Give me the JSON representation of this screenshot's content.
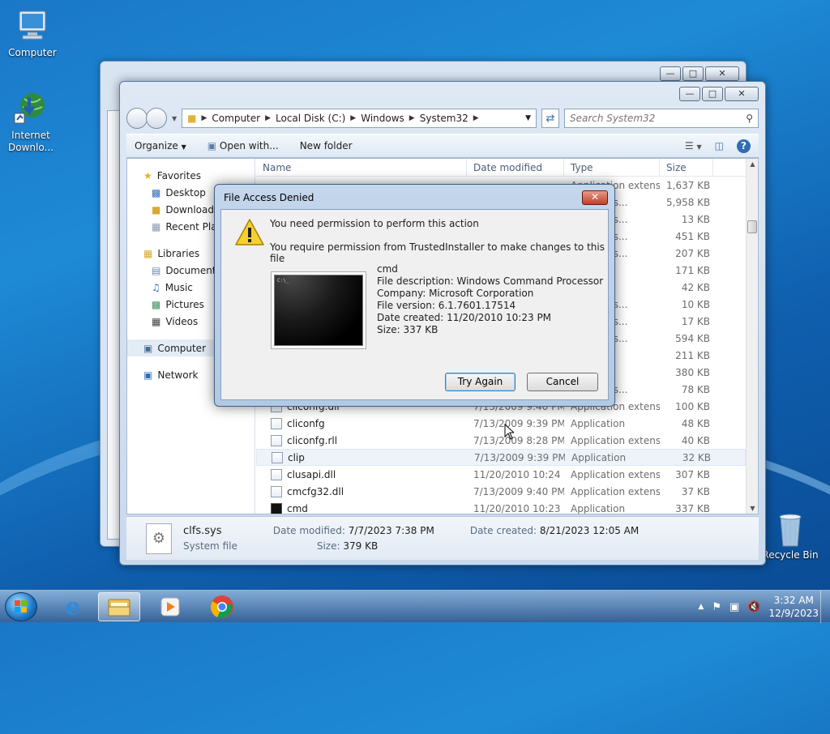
{
  "desktop": {
    "icons": [
      {
        "label": "Computer"
      },
      {
        "label": "Internet\nDownlo..."
      },
      {
        "label": "Recycle Bin"
      }
    ]
  },
  "explorer": {
    "breadcrumb": [
      "Computer",
      "Local Disk (C:)",
      "Windows",
      "System32"
    ],
    "search_placeholder": "Search System32",
    "toolbar": {
      "organize": "Organize",
      "open_with": "Open with...",
      "new_folder": "New folder"
    },
    "nav": {
      "favorites": "Favorites",
      "desktop": "Desktop",
      "downloads": "Downloads",
      "recent": "Recent Plac",
      "libraries": "Libraries",
      "documents": "Documents",
      "music": "Music",
      "pictures": "Pictures",
      "videos": "Videos",
      "computer": "Computer",
      "network": "Network"
    },
    "columns": {
      "name": "Name",
      "date": "Date modified",
      "type": "Type",
      "size": "Size"
    },
    "rows": [
      {
        "name": "",
        "date": "",
        "type": "Application extens...",
        "size": "1,637 KB"
      },
      {
        "name": "",
        "date": "",
        "type": "on extens...",
        "size": "5,958 KB"
      },
      {
        "name": "",
        "date": "",
        "type": "on extens...",
        "size": "13 KB"
      },
      {
        "name": "",
        "date": "",
        "type": "on extens...",
        "size": "451 KB"
      },
      {
        "name": "",
        "date": "",
        "type": "on extens...",
        "size": "207 KB"
      },
      {
        "name": "",
        "date": "",
        "type": "",
        "size": "171 KB"
      },
      {
        "name": "",
        "date": "",
        "type": "on",
        "size": "42 KB"
      },
      {
        "name": "",
        "date": "",
        "type": "on extens...",
        "size": "10 KB"
      },
      {
        "name": "",
        "date": "",
        "type": "on extens...",
        "size": "17 KB"
      },
      {
        "name": "",
        "date": "",
        "type": "on extens...",
        "size": "594 KB"
      },
      {
        "name": "",
        "date": "",
        "type": "on",
        "size": "211 KB"
      },
      {
        "name": "",
        "date": "",
        "type": "le",
        "size": "380 KB"
      },
      {
        "name": "",
        "date": "",
        "type": "on extens...",
        "size": "78 KB"
      },
      {
        "name": "cliconfg.dll",
        "date": "7/13/2009 9:40 PM",
        "type": "Application extens...",
        "size": "100 KB"
      },
      {
        "name": "cliconfg",
        "date": "7/13/2009 9:39 PM",
        "type": "Application",
        "size": "48 KB"
      },
      {
        "name": "cliconfg.rll",
        "date": "7/13/2009 8:28 PM",
        "type": "Application extens...",
        "size": "40 KB"
      },
      {
        "name": "clip",
        "date": "7/13/2009 9:39 PM",
        "type": "Application",
        "size": "32 KB"
      },
      {
        "name": "clusapi.dll",
        "date": "11/20/2010 10:24 ...",
        "type": "Application extens...",
        "size": "307 KB"
      },
      {
        "name": "cmcfg32.dll",
        "date": "7/13/2009 9:40 PM",
        "type": "Application extens...",
        "size": "37 KB"
      },
      {
        "name": "cmd",
        "date": "11/20/2010 10:23 ...",
        "type": "Application",
        "size": "337 KB"
      }
    ],
    "details": {
      "filename": "clfs.sys",
      "filetype": "System file",
      "date_modified_label": "Date modified:",
      "date_modified": "7/7/2023 7:38 PM",
      "date_created_label": "Date created:",
      "date_created": "8/21/2023 12:05 AM",
      "size_label": "Size:",
      "size": "379 KB"
    }
  },
  "dialog": {
    "title": "File Access Denied",
    "heading": "You need permission to perform this action",
    "message": "You require permission from TrustedInstaller to make changes to this file",
    "thumb_text": "C:\\_",
    "file": {
      "name": "cmd",
      "description": "File description: Windows Command Processor",
      "company": "Company: Microsoft Corporation",
      "version": "File version: 6.1.7601.17514",
      "created": "Date created: 11/20/2010 10:23 PM",
      "size": "Size: 337 KB"
    },
    "try_again": "Try Again",
    "cancel": "Cancel"
  },
  "taskbar": {
    "time": "3:32 AM",
    "date": "12/9/2023"
  },
  "colors": {
    "accent": "#1d73c4",
    "close_red": "#c2402b"
  }
}
